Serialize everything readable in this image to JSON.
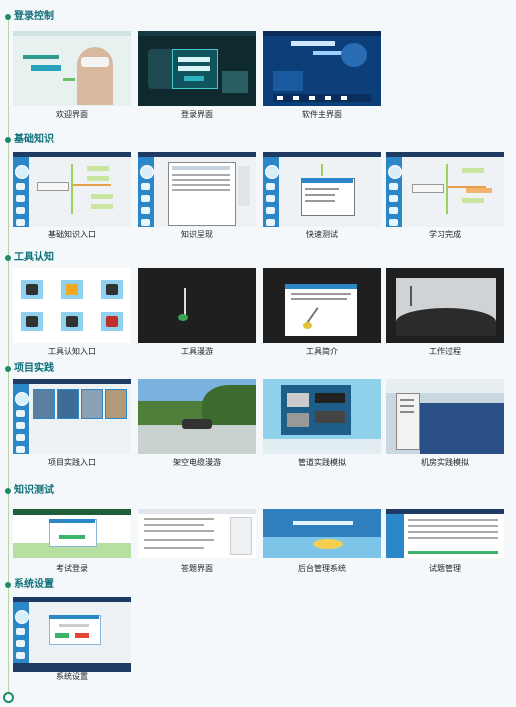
{
  "sections": [
    {
      "title": "登录控制",
      "items": [
        "欢迎界面",
        "登录界面",
        "软件主界面"
      ]
    },
    {
      "title": "基础知识",
      "items": [
        "基础知识入口",
        "知识呈现",
        "快速测试",
        "学习完成"
      ]
    },
    {
      "title": "工具认知",
      "items": [
        "工具认知入口",
        "工具漫游",
        "工具简介",
        "工作过程"
      ]
    },
    {
      "title": "项目实践",
      "items": [
        "项目实践入口",
        "架空电缆漫游",
        "管道实践模拟",
        "机房实践模拟"
      ]
    },
    {
      "title": "知识测试",
      "items": [
        "考试登录",
        "答题界面",
        "后台管理系统",
        "试题管理"
      ]
    },
    {
      "title": "系统设置",
      "items": [
        "系统设置"
      ]
    }
  ],
  "colors": {
    "accent": "#0e6f78",
    "timeline": "#1d8a6a",
    "app_header": "#1e3c63",
    "app_sidebar": "#2b87c8"
  }
}
